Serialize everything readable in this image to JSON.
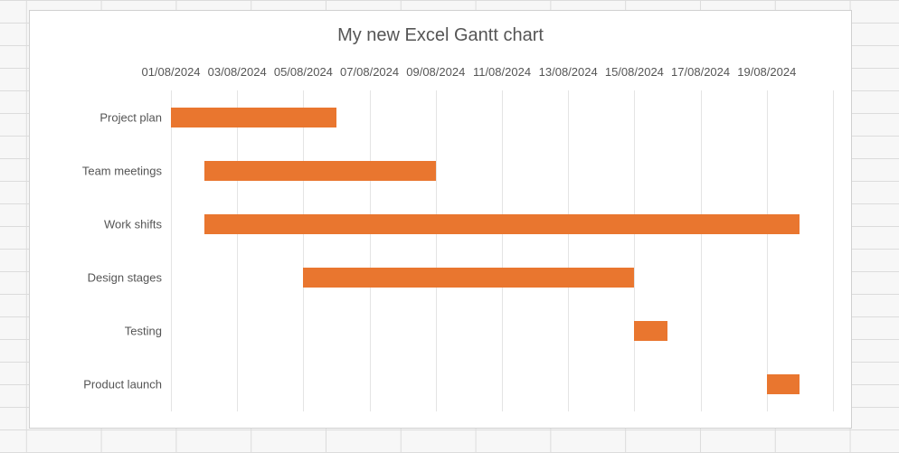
{
  "title": "My new Excel Gantt chart",
  "x_labels": [
    "01/08/2024",
    "03/08/2024",
    "05/08/2024",
    "07/08/2024",
    "09/08/2024",
    "11/08/2024",
    "13/08/2024",
    "15/08/2024",
    "17/08/2024",
    "19/08/2024"
  ],
  "colors": {
    "bar": "#e9762f"
  },
  "chart_data": {
    "type": "bar",
    "orientation": "horizontal-gantt",
    "title": "My new Excel Gantt chart",
    "xlabel": "",
    "ylabel": "",
    "x_axis": {
      "type": "date",
      "format": "DD/MM/YYYY",
      "min": "01/08/2024",
      "max": "21/08/2024",
      "tick_interval_days": 2,
      "ticks": [
        "01/08/2024",
        "03/08/2024",
        "05/08/2024",
        "07/08/2024",
        "09/08/2024",
        "11/08/2024",
        "13/08/2024",
        "15/08/2024",
        "17/08/2024",
        "19/08/2024"
      ]
    },
    "categories": [
      "Project plan",
      "Team meetings",
      "Work shifts",
      "Design stages",
      "Testing",
      "Product launch"
    ],
    "tasks": [
      {
        "name": "Project plan",
        "start": "01/08/2024",
        "end": "06/08/2024",
        "duration_days": 5
      },
      {
        "name": "Team meetings",
        "start": "02/08/2024",
        "end": "09/08/2024",
        "duration_days": 7
      },
      {
        "name": "Work shifts",
        "start": "02/08/2024",
        "end": "20/08/2024",
        "duration_days": 18
      },
      {
        "name": "Design stages",
        "start": "05/08/2024",
        "end": "15/08/2024",
        "duration_days": 10
      },
      {
        "name": "Testing",
        "start": "15/08/2024",
        "end": "16/08/2024",
        "duration_days": 1
      },
      {
        "name": "Product launch",
        "start": "19/08/2024",
        "end": "20/08/2024",
        "duration_days": 1
      }
    ]
  }
}
